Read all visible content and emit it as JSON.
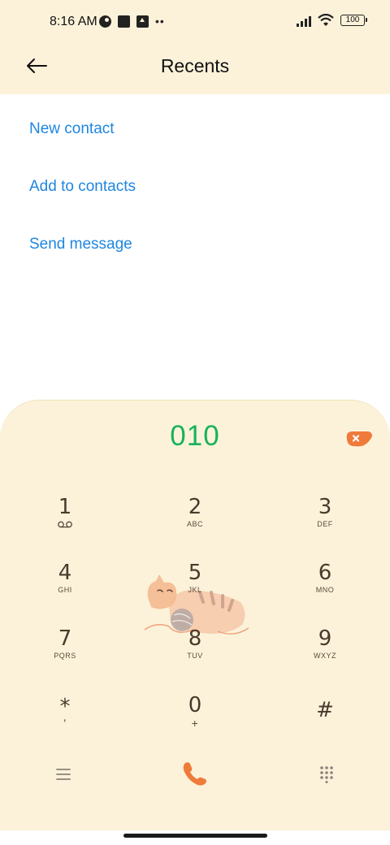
{
  "status_bar": {
    "time": "8:16 AM",
    "battery": "100"
  },
  "header": {
    "title": "Recents"
  },
  "actions": [
    {
      "label": "New contact"
    },
    {
      "label": "Add to contacts"
    },
    {
      "label": "Send message"
    }
  ],
  "dialpad": {
    "number": "010",
    "keys": [
      {
        "digit": "1",
        "letters": ""
      },
      {
        "digit": "2",
        "letters": "ABC"
      },
      {
        "digit": "3",
        "letters": "DEF"
      },
      {
        "digit": "4",
        "letters": "GHI"
      },
      {
        "digit": "5",
        "letters": "JKL"
      },
      {
        "digit": "6",
        "letters": "MNO"
      },
      {
        "digit": "7",
        "letters": "PQRS"
      },
      {
        "digit": "8",
        "letters": "TUV"
      },
      {
        "digit": "9",
        "letters": "WXYZ"
      },
      {
        "digit": "*",
        "letters": ","
      },
      {
        "digit": "0",
        "letters": "+"
      },
      {
        "digit": "#",
        "letters": ""
      }
    ]
  },
  "colors": {
    "accent_link": "#1f86e0",
    "number": "#18b35a",
    "call": "#f07a3a",
    "panel": "#fcf2da"
  },
  "icons": [
    "back-arrow-icon",
    "voicemail-icon",
    "backspace-icon",
    "menu-icon",
    "phone-icon",
    "dialpad-icon",
    "cat-decoration"
  ]
}
